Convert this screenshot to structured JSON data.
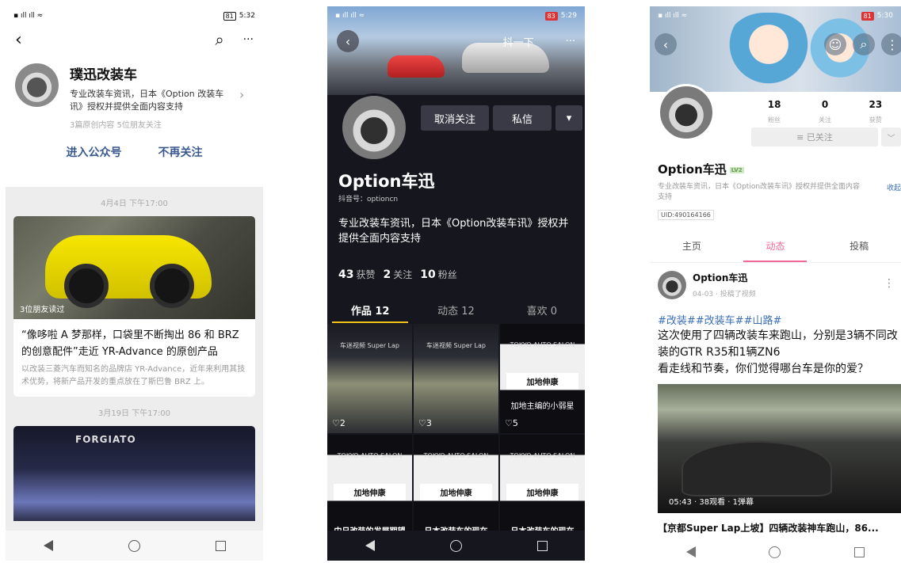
{
  "p1": {
    "status": {
      "time": "5:32",
      "battery": "81"
    },
    "toolbar": {
      "back": "‹",
      "search": "⌕",
      "more": "···"
    },
    "account": {
      "name": "璞迅改装车",
      "desc": "专业改装车资讯，日本《Option 改装车讯》授权并提供全面内容支持",
      "meta": "3篇原创内容  5位朋友关注",
      "chev": "›"
    },
    "actions": {
      "enter": "进入公众号",
      "unfollow": "不再关注"
    },
    "post1": {
      "date": "4月4日 下午17:00",
      "overlay": "3位朋友读过",
      "title": "“像哆啦 A 梦那样，口袋里不断掏出 86 和 BRZ 的创意配件”走近 YR-Advance 的原创产品",
      "summary": "以改装三菱汽车而知名的品牌店 YR-Advance，近年来利用其技术优势，将新产品开发的重点放在了斯巴鲁 BRZ 上。"
    },
    "post2": {
      "date": "3月19日 下午17:00",
      "logo": "FORGIATO"
    }
  },
  "p2": {
    "status": {
      "time": "5:29",
      "battery": "83"
    },
    "topbar": {
      "back": "‹",
      "share": "抖一下",
      "more": "···"
    },
    "buttons": {
      "unfollow": "取消关注",
      "message": "私信",
      "dropdown": "▾"
    },
    "name": "Option车迅",
    "douyin_id": "抖音号：optioncn",
    "desc": "专业改装车资讯，日本《Option改装车讯》授权并提供全面内容支持",
    "stats": [
      {
        "num": "43",
        "label": "获赞"
      },
      {
        "num": "2",
        "label": "关注"
      },
      {
        "num": "10",
        "label": "粉丝"
      }
    ],
    "tabs": [
      "作品 12",
      "动态 12",
      "喜欢 0"
    ],
    "grid": [
      {
        "cap": "车迷视频 Super Lap",
        "likes": "♡2"
      },
      {
        "cap": "车迷视频 Super Lap",
        "likes": "♡3"
      },
      {
        "cap": "TOKYO AUTO SALON",
        "big": "加地伸康",
        "bottom": "加地主编的小弱星",
        "likes": "♡5"
      },
      {
        "cap": "TOKYO AUTO SALON",
        "big": "加地伸康",
        "bottom": "中日改装的发展期望"
      },
      {
        "cap": "TOKYO AUTO SALON",
        "big": "加地伸康",
        "bottom": "日本改装车的现在"
      },
      {
        "cap": "TOKYO AUTO SALON",
        "big": "加地伸康",
        "bottom": "日本改装车的现在"
      }
    ]
  },
  "p3": {
    "status": {
      "time": "5:30",
      "battery": "81"
    },
    "stats": [
      {
        "num": "18",
        "label": "粉丝"
      },
      {
        "num": "0",
        "label": "关注"
      },
      {
        "num": "23",
        "label": "获赞"
      }
    ],
    "follow_btn": "≡ 已关注",
    "name": "Option车迅",
    "level": "LV2",
    "desc": "专业改装车资讯，日本《Option改装车讯》授权并提供全面内容支持",
    "collapse": "收起",
    "uid": "UID:490164166",
    "tabs": [
      "主页",
      "动态",
      "投稿"
    ],
    "post": {
      "author": "Option车迅",
      "meta": "04-03 · 投稿了视频",
      "tags": "#改装##改装车##山路#",
      "text": "这次使用了四辆改装车来跑山，分别是3辆不同改装的GTR R35和1辆ZN6\n看走线和节奏，你们觉得哪台车是你的爱？",
      "video_stat": "05:43 · 38观看 · 1弹幕",
      "video_title": "【京都Super Lap上坡】四辆改装神车跑山，86..."
    }
  }
}
